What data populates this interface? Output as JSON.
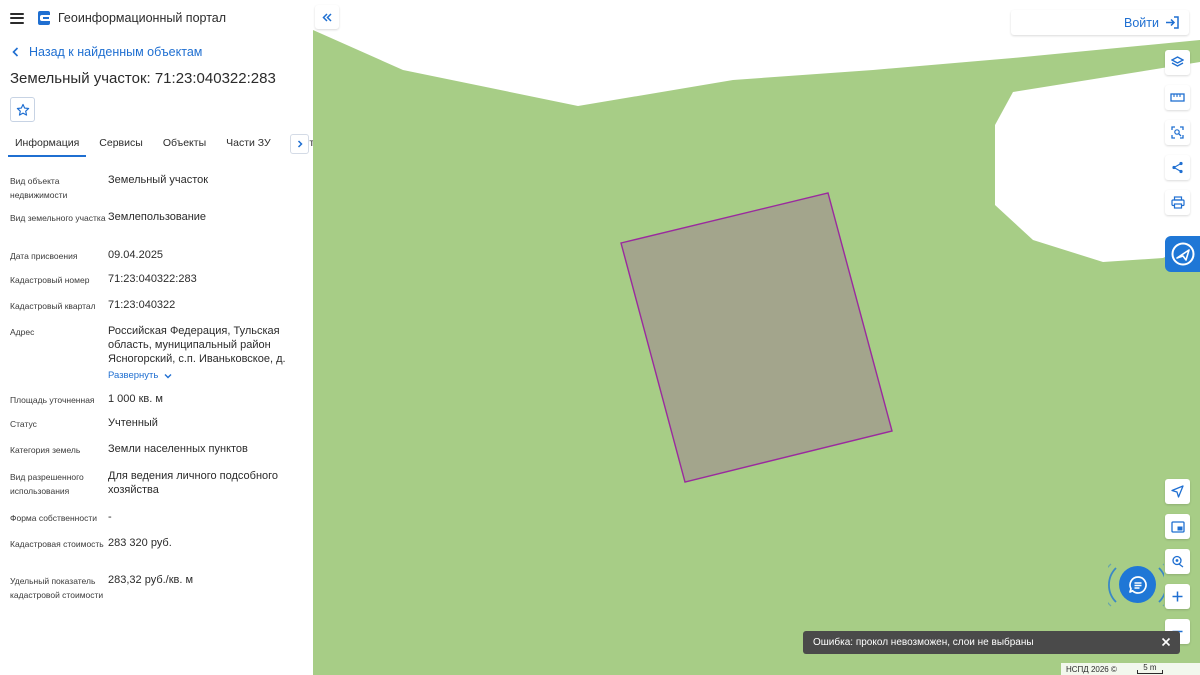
{
  "header": {
    "portal_title": "Геоинформационный портал"
  },
  "nav": {
    "back_label": "Назад к найденным объектам"
  },
  "object": {
    "title": "Земельный участок: 71:23:040322:283"
  },
  "tabs": [
    {
      "label": "Информация",
      "active": true
    },
    {
      "label": "Сервисы"
    },
    {
      "label": "Объекты"
    },
    {
      "label": "Части ЗУ"
    },
    {
      "label": "Состав"
    }
  ],
  "properties": [
    {
      "label": "Вид объекта недвижимости",
      "value": "Земельный участок"
    },
    {
      "label": "Вид земельного участка",
      "value": "Землепользование"
    },
    {
      "label": "Дата присвоения",
      "value": "09.04.2025"
    },
    {
      "label": "Кадастровый номер",
      "value": "71:23:040322:283"
    },
    {
      "label": "Кадастровый квартал",
      "value": "71:23:040322"
    },
    {
      "label": "Адрес",
      "value": "Российская Федерация, Тульская область, муниципальный район Ясногорский, с.п. Иваньковское, д.",
      "expand_label": "Развернуть"
    },
    {
      "label": "Площадь уточненная",
      "value": "1 000 кв. м"
    },
    {
      "label": "Статус",
      "value": "Учтенный"
    },
    {
      "label": "Категория земель",
      "value": "Земли населенных пунктов"
    },
    {
      "label": "Вид разрешенного использования",
      "value": "Для ведения личного подсобного хозяйства"
    },
    {
      "label": "Форма собственности",
      "value": "-"
    },
    {
      "label": "Кадастровая стоимость",
      "value": "283 320 руб."
    },
    {
      "label": "Удельный показатель кадастровой стоимости",
      "value": "283,32 руб./кв. м"
    }
  ],
  "map": {
    "login_label": "Войти",
    "toast_message": "Ошибка: прокол невозможен, слои не выбраны",
    "attribution": "НСПД 2026 ©",
    "scale_label": "5 m",
    "colors": {
      "land": "#a7cd86",
      "road": "#ffffff",
      "parcel_fill": "#a3a58c",
      "parcel_stroke": "#9a2a9e",
      "accent": "#1f6fd1"
    }
  }
}
